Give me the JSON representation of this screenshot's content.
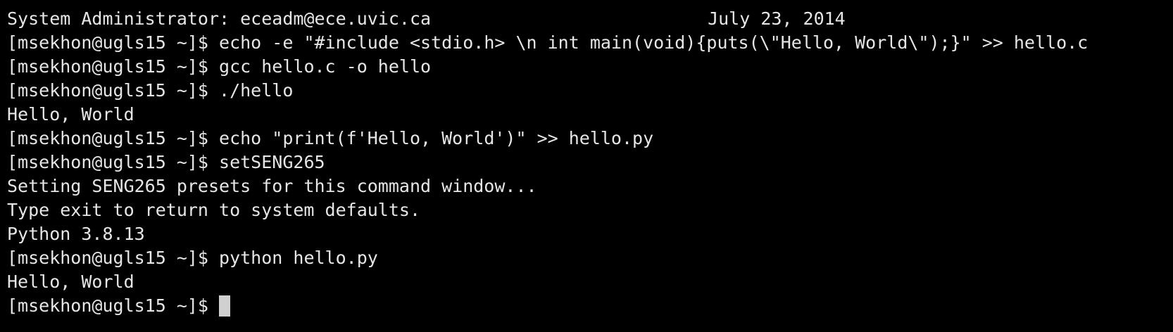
{
  "header": {
    "admin": "System Administrator: eceadm@ece.uvic.ca",
    "date": "July 23, 2014"
  },
  "prompt": "[msekhon@ugls15 ~]$ ",
  "lines": [
    {
      "type": "cmd",
      "text": "echo -e \"#include <stdio.h> \\n int main(void){puts(\\\"Hello, World\\\");}\" >> hello.c"
    },
    {
      "type": "cmd",
      "text": "gcc hello.c -o hello"
    },
    {
      "type": "cmd",
      "text": "./hello"
    },
    {
      "type": "out",
      "text": "Hello, World"
    },
    {
      "type": "cmd",
      "text": "echo \"print(f'Hello, World')\" >> hello.py"
    },
    {
      "type": "cmd",
      "text": "setSENG265"
    },
    {
      "type": "out",
      "text": "Setting SENG265 presets for this command window..."
    },
    {
      "type": "out",
      "text": "Type exit to return to system defaults."
    },
    {
      "type": "out",
      "text": "Python 3.8.13"
    },
    {
      "type": "cmd",
      "text": "python hello.py"
    },
    {
      "type": "out",
      "text": "Hello, World"
    },
    {
      "type": "cmd",
      "text": ""
    }
  ],
  "colors": {
    "background": "#000000",
    "foreground": "#e6e6e6",
    "cursor": "#d0d0d0"
  }
}
